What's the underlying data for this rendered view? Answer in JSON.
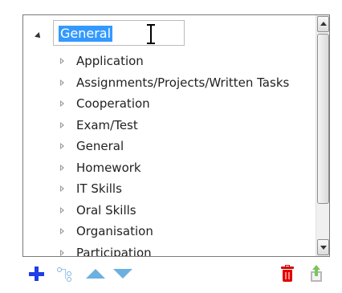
{
  "tree": {
    "root": {
      "label": "General",
      "expanded": true
    },
    "children": [
      "Application",
      "Assignments/Projects/Written Tasks",
      "Cooperation",
      "Exam/Test",
      "General",
      "Homework",
      "IT Skills",
      "Oral Skills",
      "Organisation",
      "Participation"
    ]
  },
  "toolbar": {
    "buttons": [
      {
        "name": "add-button",
        "icon": "plus-icon",
        "color": "#1f3ee6"
      },
      {
        "name": "add-child-button",
        "icon": "hierarchy-icon",
        "color": "#9cc4e8"
      },
      {
        "name": "move-up-button",
        "icon": "triangle-up-icon",
        "color": "#6cb0e0"
      },
      {
        "name": "move-down-button",
        "icon": "triangle-down-icon",
        "color": "#6cb0e0"
      },
      {
        "name": "delete-button",
        "icon": "trash-icon",
        "color": "#e20000"
      },
      {
        "name": "export-button",
        "icon": "export-icon",
        "color": "#7bc45c"
      }
    ]
  }
}
